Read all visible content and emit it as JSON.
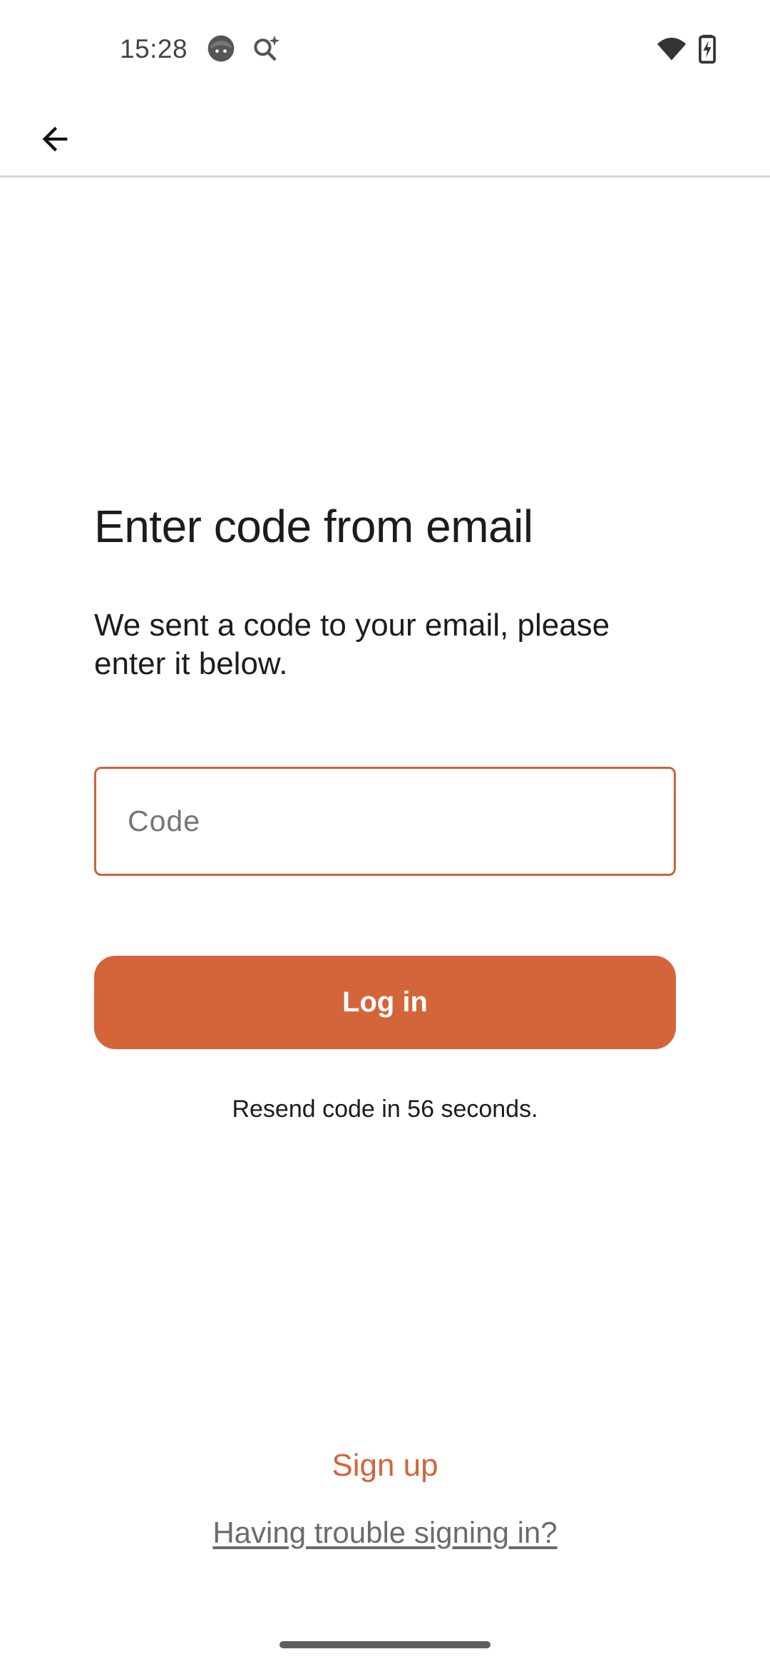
{
  "status_bar": {
    "time": "15:28",
    "icons": [
      "face-icon",
      "search-sparkle-icon",
      "wifi-icon",
      "battery-charging-icon"
    ]
  },
  "app_bar": {
    "back_icon": "arrow-back-icon"
  },
  "main": {
    "title": "Enter code from email",
    "description": "We sent a code to your email, please enter it below.",
    "code_field": {
      "placeholder": "Code",
      "value": ""
    },
    "login_label": "Log in",
    "resend_text": "Resend code in 56 seconds."
  },
  "footer": {
    "signup_label": "Sign up",
    "trouble_label": "Having trouble signing in?"
  },
  "colors": {
    "accent": "#d4643a",
    "text": "#1c1c1c",
    "muted_link": "#6b6b6b"
  }
}
